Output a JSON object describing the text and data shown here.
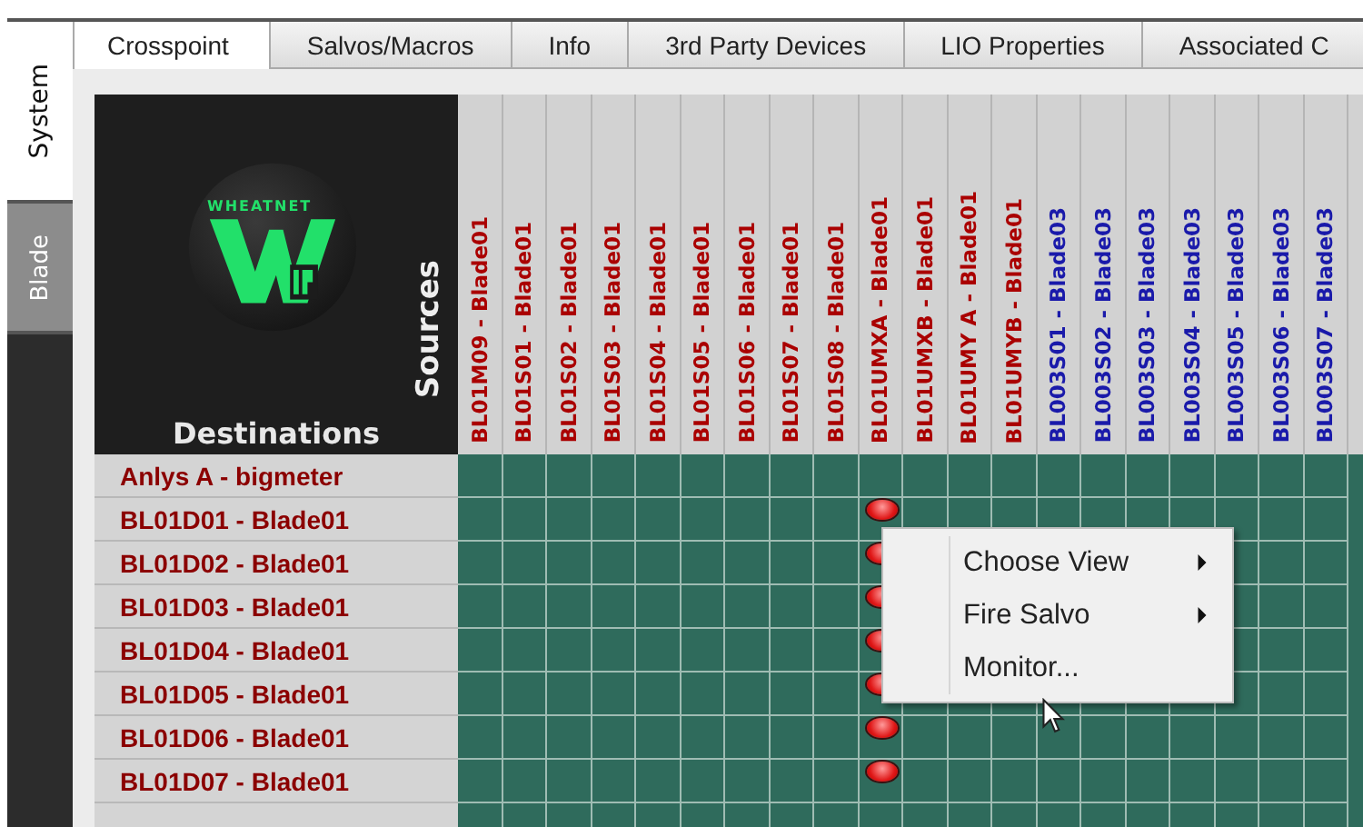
{
  "side_tabs": [
    {
      "label": "System",
      "selected": true
    },
    {
      "label": "Blade",
      "selected": false
    }
  ],
  "tabs": [
    {
      "label": "Crosspoint",
      "selected": true
    },
    {
      "label": "Salvos/Macros",
      "selected": false
    },
    {
      "label": "Info",
      "selected": false
    },
    {
      "label": "3rd Party Devices",
      "selected": false
    },
    {
      "label": "LIO Properties",
      "selected": false
    },
    {
      "label": "Associated C",
      "selected": false
    }
  ],
  "logo": {
    "wordmark": "WHEATNET"
  },
  "sources_title": "Sources",
  "destinations_title": "Destinations",
  "sources": [
    {
      "label": "BL01M09 - Blade01",
      "color": "#aa0000"
    },
    {
      "label": "BL01S01 - Blade01",
      "color": "#aa0000"
    },
    {
      "label": "BL01S02 - Blade01",
      "color": "#aa0000"
    },
    {
      "label": "BL01S03 - Blade01",
      "color": "#aa0000"
    },
    {
      "label": "BL01S04 - Blade01",
      "color": "#aa0000"
    },
    {
      "label": "BL01S05 - Blade01",
      "color": "#aa0000"
    },
    {
      "label": "BL01S06 - Blade01",
      "color": "#aa0000"
    },
    {
      "label": "BL01S07 - Blade01",
      "color": "#aa0000"
    },
    {
      "label": "BL01S08 - Blade01",
      "color": "#aa0000"
    },
    {
      "label": "BL01UMXA - Blade01",
      "color": "#aa0000"
    },
    {
      "label": "BL01UMXB - Blade01",
      "color": "#aa0000"
    },
    {
      "label": "BL01UMY A - Blade01",
      "color": "#aa0000"
    },
    {
      "label": "BL01UMYB - Blade01",
      "color": "#aa0000"
    },
    {
      "label": "BL003S01 - Blade03",
      "color": "#1a1aaa"
    },
    {
      "label": "BL003S02 - Blade03",
      "color": "#1a1aaa"
    },
    {
      "label": "BL003S03 - Blade03",
      "color": "#1a1aaa"
    },
    {
      "label": "BL003S04 - Blade03",
      "color": "#1a1aaa"
    },
    {
      "label": "BL003S05 - Blade03",
      "color": "#1a1aaa"
    },
    {
      "label": "BL003S06 - Blade03",
      "color": "#1a1aaa"
    },
    {
      "label": "BL003S07 - Blade03",
      "color": "#1a1aaa"
    }
  ],
  "destinations": [
    {
      "label": "Anlys A - bigmeter",
      "crosspoints": [
        false,
        false,
        false,
        false,
        false,
        false,
        false,
        false,
        false,
        false,
        false,
        false,
        false,
        false,
        false,
        false,
        false,
        false,
        false,
        false
      ]
    },
    {
      "label": "BL01D01 - Blade01",
      "crosspoints": [
        false,
        false,
        false,
        false,
        false,
        false,
        false,
        false,
        false,
        true,
        false,
        false,
        false,
        false,
        false,
        false,
        false,
        false,
        false,
        false
      ]
    },
    {
      "label": "BL01D02 - Blade01",
      "crosspoints": [
        false,
        false,
        false,
        false,
        false,
        false,
        false,
        false,
        false,
        true,
        false,
        false,
        false,
        false,
        false,
        false,
        false,
        false,
        false,
        false
      ]
    },
    {
      "label": "BL01D03 - Blade01",
      "crosspoints": [
        false,
        false,
        false,
        false,
        false,
        false,
        false,
        false,
        false,
        true,
        false,
        false,
        false,
        false,
        false,
        false,
        false,
        false,
        false,
        false
      ]
    },
    {
      "label": "BL01D04 - Blade01",
      "crosspoints": [
        false,
        false,
        false,
        false,
        false,
        false,
        false,
        false,
        false,
        true,
        false,
        false,
        false,
        false,
        false,
        false,
        false,
        false,
        false,
        false
      ]
    },
    {
      "label": "BL01D05 - Blade01",
      "crosspoints": [
        false,
        false,
        false,
        false,
        false,
        false,
        false,
        false,
        false,
        true,
        false,
        false,
        false,
        false,
        false,
        false,
        false,
        false,
        false,
        false
      ]
    },
    {
      "label": "BL01D06 - Blade01",
      "crosspoints": [
        false,
        false,
        false,
        false,
        false,
        false,
        false,
        false,
        false,
        true,
        false,
        false,
        false,
        false,
        false,
        false,
        false,
        false,
        false,
        false
      ]
    },
    {
      "label": "BL01D07 - Blade01",
      "crosspoints": [
        false,
        false,
        false,
        false,
        false,
        false,
        false,
        false,
        false,
        true,
        false,
        false,
        false,
        false,
        false,
        false,
        false,
        false,
        false,
        false
      ]
    }
  ],
  "context_menu": [
    {
      "label": "Choose View",
      "submenu": true
    },
    {
      "label": "Fire Salvo",
      "submenu": true
    },
    {
      "label": "Monitor...",
      "submenu": false
    }
  ]
}
